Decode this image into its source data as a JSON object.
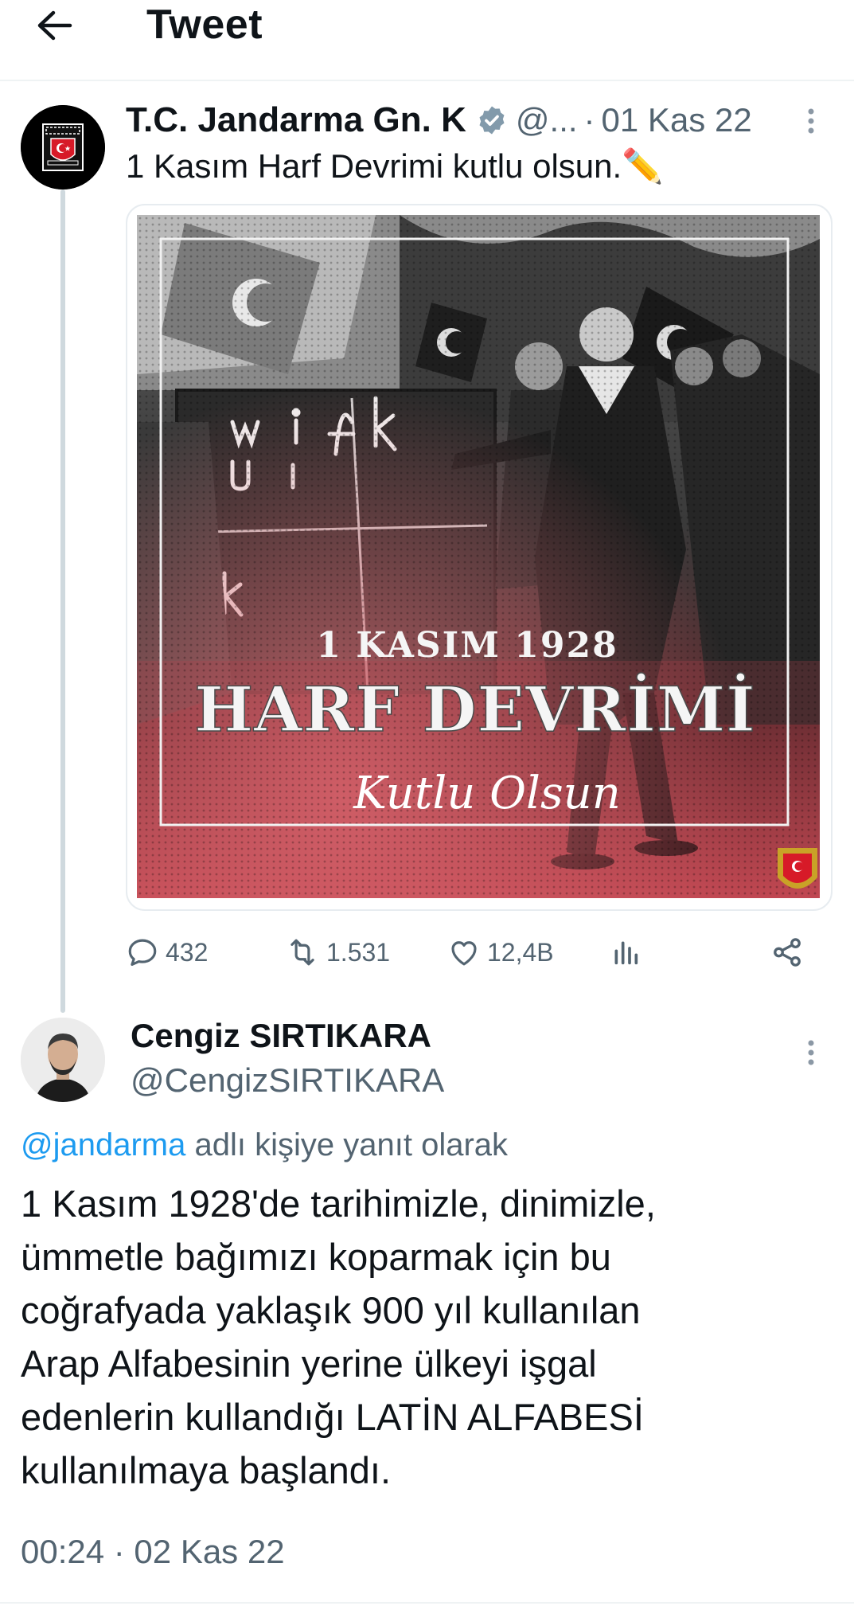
{
  "header": {
    "title": "Tweet",
    "back_icon": "arrow-left-icon"
  },
  "tweet": {
    "author_name": "T.C. Jandarma Gn. K",
    "handle": "@...",
    "separator": "·",
    "date": "01 Kas 22",
    "text": "1 Kasım Harf Devrimi kutlu olsun.",
    "pencil_emoji": "✏️",
    "image": {
      "line1": "1 KASIM 1928",
      "line2": "HARF DEVRİMİ",
      "line3": "Kutlu Olsun",
      "board_letters": [
        "w",
        "i",
        "f",
        "k",
        "ü",
        "i",
        "k"
      ]
    },
    "stats": {
      "replies": "432",
      "retweets": "1.531",
      "likes": "12,4B"
    },
    "icons": [
      "reply-icon",
      "retweet-icon",
      "like-icon",
      "analytics-icon",
      "share-icon"
    ]
  },
  "reply": {
    "author_name": "Cengiz SIRTIKARA",
    "handle": "@CengizSIRTIKARA",
    "replying_to_handle": "@jandarma",
    "replying_to_suffix": "adlı kişiye yanıt olarak",
    "text_lines": [
      "1 Kasım 1928'de tarihimizle, dinimizle,",
      "ümmetle bağımızı koparmak için bu",
      "coğrafyada yaklaşık 900 yıl kullanılan",
      "Arap Alfabesinin yerine ülkeyi işgal",
      "edenlerin kullandığı LATİN ALFABESİ",
      "kullanılmaya başlandı."
    ],
    "timestamp": "00:24 · 02 Kas 22"
  },
  "colors": {
    "accent": "#1d9bf0",
    "muted": "#536471",
    "text": "#0f1419",
    "divider": "#eff3f4"
  }
}
